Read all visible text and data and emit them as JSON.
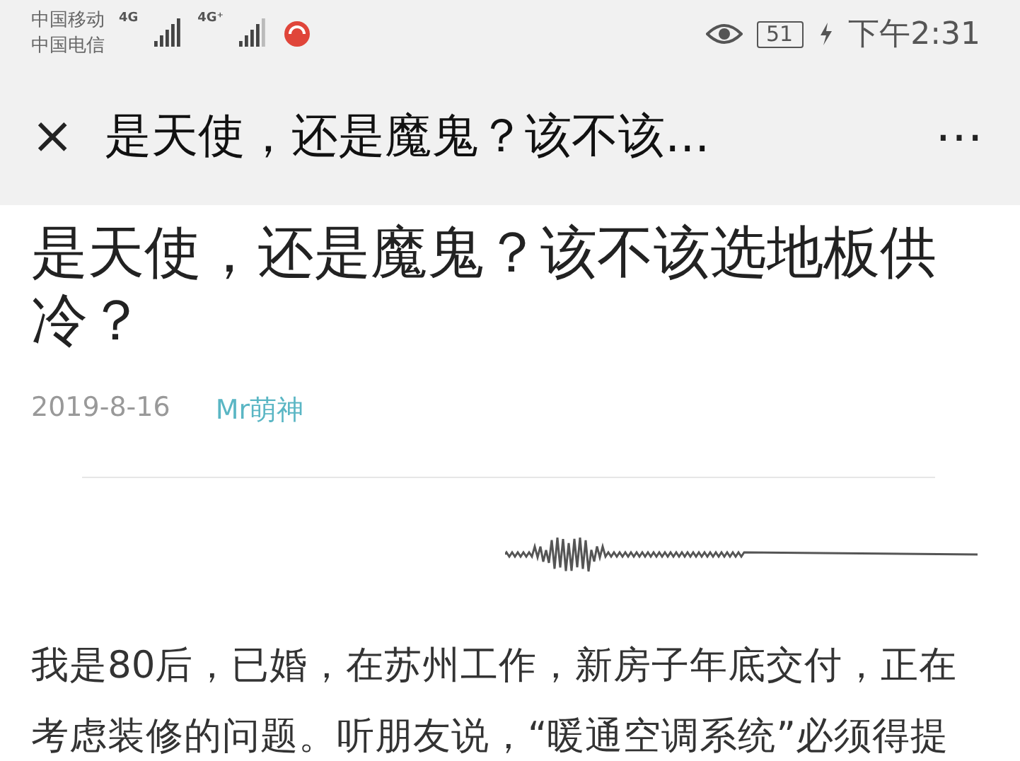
{
  "status_bar": {
    "carriers": [
      "中国移动",
      "中国电信"
    ],
    "network_labels": [
      "4G",
      "4G⁺"
    ],
    "battery": "51",
    "time": "下午2:31"
  },
  "toolbar": {
    "close": "×",
    "title": "是天使，还是魔鬼？该不该...",
    "more": "⋯"
  },
  "article": {
    "title_lines": [
      "是天使，还是魔鬼？该不该选地板供",
      "冷？"
    ],
    "date": "2019-8-16",
    "author": "Mr萌神",
    "body_lines": [
      "我是80后，已婚，在苏州工作，新房子年底交付，正在",
      "考虑装修的问题。听朋友说，“暖通空调系统”必须得提"
    ]
  }
}
